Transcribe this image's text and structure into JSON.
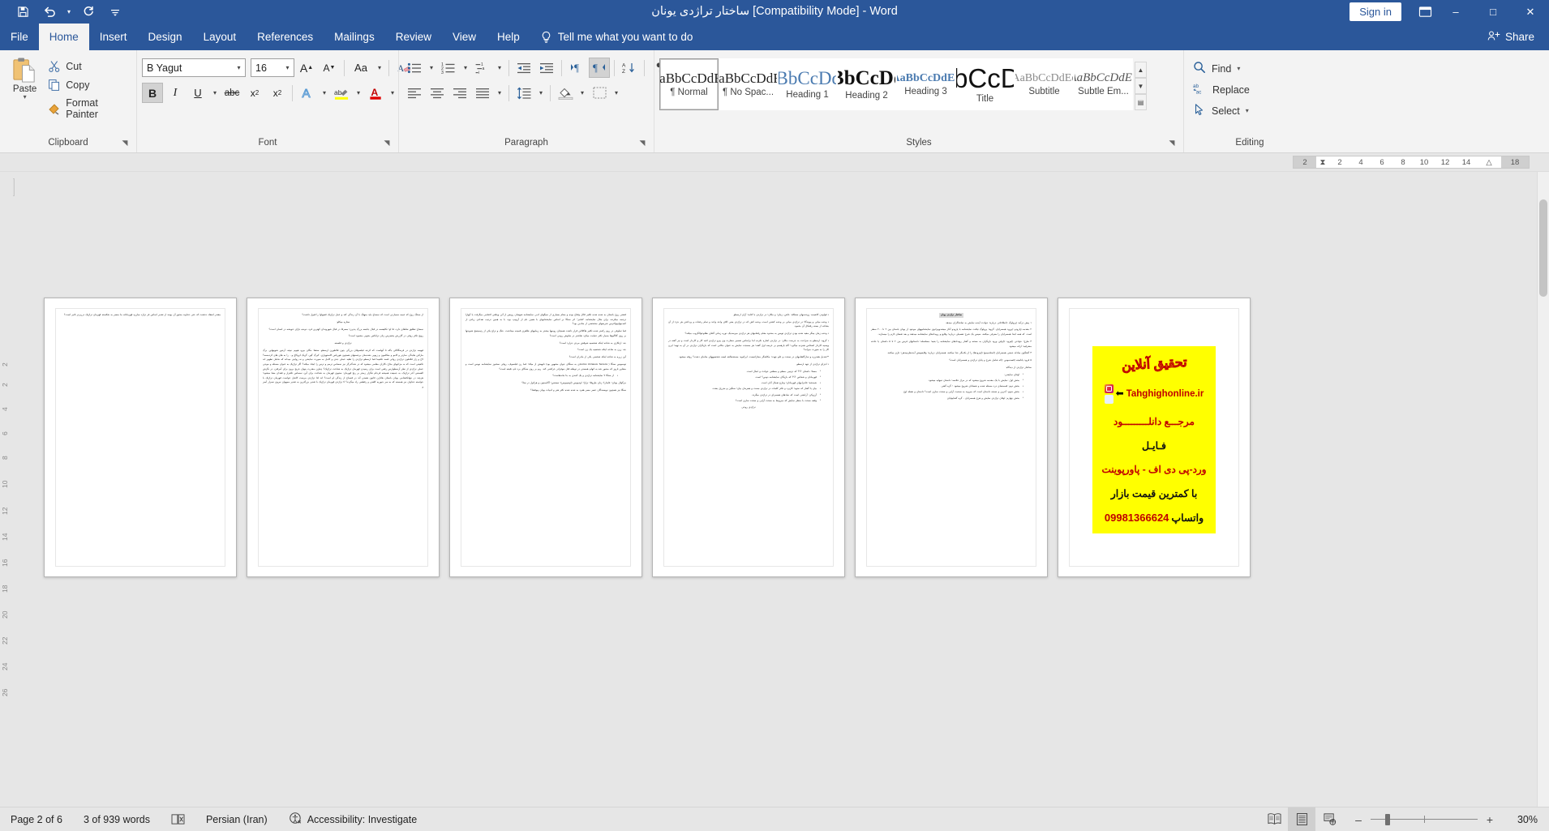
{
  "window": {
    "title": "ساختار تراژدی یونان [Compatibility Mode]  -  Word",
    "sign_in": "Sign in",
    "account_icon": "account-icon",
    "minimize": "–",
    "maximize": "□",
    "close": "✕",
    "accent_color": "#2b579a"
  },
  "quick_access": [
    {
      "name": "save-icon",
      "label": "Save"
    },
    {
      "name": "undo-icon",
      "label": "Undo"
    },
    {
      "name": "undo-dropdown-icon",
      "label": "Undo options"
    },
    {
      "name": "redo-icon",
      "label": "Redo"
    },
    {
      "name": "customize-qat-icon",
      "label": "Customize Quick Access Toolbar"
    }
  ],
  "tabs": [
    {
      "label": "File",
      "active": false
    },
    {
      "label": "Home",
      "active": true
    },
    {
      "label": "Insert",
      "active": false
    },
    {
      "label": "Design",
      "active": false
    },
    {
      "label": "Layout",
      "active": false
    },
    {
      "label": "References",
      "active": false
    },
    {
      "label": "Mailings",
      "active": false
    },
    {
      "label": "Review",
      "active": false
    },
    {
      "label": "View",
      "active": false
    },
    {
      "label": "Help",
      "active": false
    }
  ],
  "tell_me": {
    "label": "Tell me what you want to do",
    "icon": "lightbulb-icon"
  },
  "share": {
    "label": "Share",
    "icon": "share-person-icon"
  },
  "ribbon": {
    "clipboard": {
      "group_label": "Clipboard",
      "paste_label": "Paste",
      "items": [
        {
          "label": "Cut",
          "icon": "scissors-icon"
        },
        {
          "label": "Copy",
          "icon": "copy-icon"
        },
        {
          "label": "Format Painter",
          "icon": "format-painter-icon"
        }
      ]
    },
    "font": {
      "group_label": "Font",
      "font_name": "B Yagut",
      "font_size": "16",
      "buttons_row1": [
        {
          "name": "grow-font-button",
          "glyph": "A"
        },
        {
          "name": "shrink-font-button",
          "glyph": "A"
        },
        {
          "name": "change-case-button",
          "glyph": "Aa"
        },
        {
          "name": "clear-formatting-button",
          "glyph": "A"
        }
      ],
      "buttons_row2": [
        {
          "name": "bold-button",
          "glyph": "B",
          "active": true
        },
        {
          "name": "italic-button",
          "glyph": "I",
          "active": false
        },
        {
          "name": "underline-button",
          "glyph": "U",
          "active": false
        },
        {
          "name": "strikethrough-button",
          "glyph": "abc",
          "active": false
        },
        {
          "name": "subscript-button",
          "glyph": "x₂",
          "active": false
        },
        {
          "name": "superscript-button",
          "glyph": "x²",
          "active": false
        },
        {
          "name": "text-effects-button",
          "glyph": "A",
          "active": false
        },
        {
          "name": "text-highlight-button",
          "glyph": "ab",
          "active": false
        },
        {
          "name": "font-color-button",
          "glyph": "A",
          "active": false
        }
      ],
      "font_color": "#d10000",
      "highlight_color": "#ffff00"
    },
    "paragraph": {
      "group_label": "Paragraph",
      "row1": [
        {
          "name": "bullets-button"
        },
        {
          "name": "numbering-button"
        },
        {
          "name": "multilevel-list-button"
        },
        {
          "name": "decrease-indent-button"
        },
        {
          "name": "increase-indent-button"
        },
        {
          "name": "ltr-text-direction-button"
        },
        {
          "name": "rtl-text-direction-button",
          "active": true
        },
        {
          "name": "sort-button"
        },
        {
          "name": "show-formatting-marks-button"
        }
      ],
      "row2": [
        {
          "name": "align-left-button"
        },
        {
          "name": "align-center-button"
        },
        {
          "name": "align-right-button"
        },
        {
          "name": "justify-button"
        },
        {
          "name": "line-spacing-button"
        },
        {
          "name": "shading-button"
        },
        {
          "name": "borders-button"
        }
      ]
    },
    "styles": {
      "group_label": "Styles",
      "gallery": [
        {
          "preview": "AaBbCcDdEe",
          "name": "¶ Normal",
          "selected": true,
          "style": "normal"
        },
        {
          "preview": "AaBbCcDdEe",
          "name": "¶ No Spac...",
          "selected": false,
          "style": "nospacing"
        },
        {
          "preview": "AaBbCcDdEe",
          "name": "Heading 1",
          "selected": false,
          "style": "h1"
        },
        {
          "preview": "AaBbCcDdEe",
          "name": "Heading 2",
          "selected": false,
          "style": "h2"
        },
        {
          "preview": "AaBbCcDdEe",
          "name": "Heading 3",
          "selected": false,
          "style": "h3"
        },
        {
          "preview": "AaBbCcDdEe",
          "name": "Title",
          "selected": false,
          "style": "title"
        },
        {
          "preview": "AaBbCcDdEe",
          "name": "Subtitle",
          "selected": false,
          "style": "subtitle"
        },
        {
          "preview": "AaBbCcDdEe",
          "name": "Subtle Em...",
          "selected": false,
          "style": "subtle"
        }
      ]
    },
    "editing": {
      "group_label": "Editing",
      "items": [
        {
          "label": "Find",
          "icon": "search-icon",
          "has_arrow": true
        },
        {
          "label": "Replace",
          "icon": "replace-icon",
          "has_arrow": false
        },
        {
          "label": "Select",
          "icon": "select-cursor-icon",
          "has_arrow": true
        }
      ]
    }
  },
  "ruler": {
    "ticks": [
      "18",
      "",
      "14",
      "12",
      "10",
      "8",
      "6",
      "4",
      "2",
      "",
      "2"
    ]
  },
  "vertical_ruler_numbers": [
    "2",
    "2",
    "4",
    "6",
    "8",
    "10",
    "12",
    "14",
    "16",
    "18",
    "20",
    "22",
    "24",
    "26"
  ],
  "document": {
    "pages": [
      {
        "page_number": 1,
        "type": "text",
        "blocks": [
          {
            "kind": "p",
            "text": "مقتدر انعقاد دخشت که حتی خداوند مخیق آن یونند از تقدیر اساس فر تراژد مبارزه قهرمانانه ما منصر به شکسته قهرمان تراژیک درربرتر تاثیر است؟"
          }
        ]
      },
      {
        "page_number": 2,
        "type": "text",
        "blocks": [
          {
            "kind": "p",
            "text": "از سخگ روح که خیمه سمبارتی است که نمساج باید منهنگ با آن زندگی کند و عمل تراژیک قصهاوا را قبول داشت؟"
          },
          {
            "kind": "bullet",
            "text": "ستاره میکلو:"
          },
          {
            "kind": "p",
            "text": "نمساج تظلیق نقاطای دارد، فا او؛ تکلیفسه در قبال جامعه بزرگ پذیرن؛ مصرفا در قبال شهروندان کهترین فرد، دونده بازای خویشه در انسان است؟"
          },
          {
            "kind": "p",
            "text": "رویج تکثر روقی در گازرش یخصرص زنان ترانکس بخوبی مشیود است؟"
          },
          {
            "kind": "p",
            "text": "تراژدی و فلسفه"
          },
          {
            "kind": "p",
            "text": "فهیمه تراژدی در فرمنگاکلی باکه تا آنهاست که کرجه فیلسوفان بزرگی چون فلاطورن ارسطو. سقفا: مگان بیرو، هیوم. نیچه، آرنتور شوپنهاور. برگ مارکین هایدگر، سارتر و کامو و متکلمون و زیوبی شندمنان برجستهای همچون هوریاس کاستوواری. کیرگ گور، گریک لزوکاچ و... را به های های کردمسه؟ لاح و زار فلاطون تراژدی روانی فسد تکفیما فما ارسطو تراژدی را تقلید عملی جدی و کامل به صورت نمایشی و نه روایتی میداند که شامل تطهیر اند تکفیفی است که به مزاجهای بجاح دکاران مقلمی میشود که در شدگدرگز نیز نمساس ترمم و ترس را ایجاد میکند؟ اگر تراژیک به عنوان مسئله و موجی عملی تراژدی از نظر آرسطوارس رفعی است برای رسیدن قهرمان تراژیک به شناخت تراژیک؟ چیلرن مقدرت پنهان خربج برون برای آمرفتن، در نگرش الفسفی آخر تراژیک، به جمیعت همیشه فرجام تنگزار زمجر بر رنج قهرمان: ستیوی قهرمان به شناخت برای آین، نمساس تکفرار و فقدان معنا میشود؛ هرچند در جهانکنشامی یونان باستان هادارن قانون هستی آند در فنساج از زندگی او است؟ اند لذا تراژدی مرصت کاشل خواست قهرمان تراژیک با خواسته خداوان نیز همسته که به سر جیوریه کلفتی و رقطعی راد میگردد؟ لا تراژدی قهرمان تراژیک با تقدیر بزرگترین به تقدیر ممهوان نیروی نسرار آمیز و"
          }
        ]
      },
      {
        "page_number": 3,
        "type": "text",
        "blocks": [
          {
            "kind": "p",
            "text": "قشتی روح باستان به شده شده تکثیر قائل وقتاح بوده و مقام بسیاری از سیگهای ادبی نمایشنامه شهسان روبس از آتن وینلقی افتنامی میگرفت یا آنهارا ترجمه میکردند برای مثال نمایشنامه \"قنامر\" اثر سنگا بر اساس نمایشنامهای با همین نام از آریپیپ بود، با به همین ترتیب تعدادی زیادی از کمدینهایپیولاترس شریحهای مشخصی از منادین بود؟"
          },
          {
            "kind": "p",
            "text": "فما تملوفی در روم رکمتر شده تکثیر هاکلااین قرار داشت همچنان رومیها بیشتر به زیباییهای ظاهری قمیده میداشت. جنگ و نزاع یکی از رتیمیتینج شیوجها بر روی گلاگیوها بسیار تکثر خمایت میکرد نقاشتر در سلوش رومی است؟"
          },
          {
            "kind": "p",
            "text": "جه: ارتکاری به شاخه اینکه شخصیه شوقش مردی جرارذ است؟"
          },
          {
            "kind": "p",
            "text": "جه: زرن به شاخه اینکه شخصیه یک زن است؟"
          },
          {
            "kind": "p",
            "text": "آین زرره به شاخه اینکه شخصی یکی از مادران است؟"
          },
          {
            "kind": "p",
            "text": "توسیوس سنگا ( Lucius Annaeus Senecaی به سنگای جوان مشهور بود) نانهیش از میلاد؛ فما رن فیلسوف، روقی سخنوز نمایشنامه نویس است و مشاور ناروز که مجبور شد به اتهام همستی در توطئه قتل نیوفرادر خرکشی کند. ریم بر روی سنگای برد نام دقیقه است؟"
          },
          {
            "kind": "list",
            "text": "از ستگا ۹ نمایشنامه تراژدی و یک کمدی به جا ماندهاست؟"
          },
          {
            "kind": "p",
            "text": "مرگولل یونان؛    فایدارا؛    زنان طروقا؛    ترازا؛    اودیپوس (اوسپیوس)؛    تیستس؛    آگاممنون و هرکول در تیتا؟"
          },
          {
            "kind": "p",
            "text": "سنگا نیز همچون نویسندگان عصر مصر هفرد به شده شده تکثر هنر و ادبیات یونان پیوقشا؟"
          }
        ]
      },
      {
        "page_number": 4,
        "type": "text",
        "blocks": [
          {
            "kind": "p",
            "text": "• فولودن کاتفیده: زوحدمهای سفکله: خاش، زمان؛ و مکان؛ در تراژدی با کتابه؛ آران ارسطو"
          },
          {
            "kind": "p",
            "text": "• وحده میانی و پیوندگا؛ در تراژدی میانی بر وحده کشتی است، وحده کش که در تراژدی یعنی کلای واحد واحد و تمام رخقات و پرداختن هر جزء از آن بشاخه از بسته رفتنکل آن بخمود."
          },
          {
            "kind": "p",
            "text": "• وحده زمان بینگر مقید شده بودن تراژدی تویس به محدود مقام رفتنامهای هر تراژدی میرسدیک دوره زمانی آفتای نظلوعوالگروب میکند؟"
          },
          {
            "kind": "p",
            "text": "• گروه: ارسطو به صراحت به جرمنت مکان: در تراژدی اشاره نکرده اما براساس تفسیر سفارت وی پیرو تراژدی افید کار و کاردار است و نیز گفته در ویسیه کاردار اشخاص همزده میگیرد؛ گاه بازهسم بر عرصه اول گفته؛ هر مسجت نمایش به عنوان مکانی است که بازیگران تراژدی در آن به تهیه؛ ایرن کار را به صورت میزانه؟"
          },
          {
            "kind": "p",
            "text": "**تجدیل هفدرزه و نمازگاهنامهای در صحت و علو جهت؛ مکاشگر مجازاتیست. ایرکیوه: مستحمالقه لیسه شخصیههای متامای دشت؟ روقه میشود."
          },
          {
            "kind": "p",
            "text": "• اجزای تراژدی از جهد ارسطو"
          },
          {
            "kind": "list",
            "text": "مستا؛ داستان ؟؟؟ که ترتیبی منظم و منطقی حوادث و غمال است."
          },
          {
            "kind": "list",
            "text": "قهرمانان و شخاص ؟؟؟ که بازیگان نمایشنامه دوس؟ است."
          },
          {
            "kind": "list",
            "text": "شیدشه؛ فاجرامهای قهرمانان؛ وتازع تعمال آنان است."
          },
          {
            "kind": "list",
            "text": "بیان یا گفتار که نحوه؛ کاربرد و تکثر کلمات در تراژدی مست و همزمان بیان؛ سنگین و مترزق بشت."
          },
          {
            "kind": "list",
            "text": "آرزوکی: آرایشی است که نمادهای همسرای در تراژدی میگردد."
          },
          {
            "kind": "list",
            "text": "وقعه صحت با منظر نمایش که میروبط به صحت آرایی و صحت سازی است؟"
          },
          {
            "kind": "p",
            "text": "تراژدی روحی"
          }
        ]
      },
      {
        "page_number": 5,
        "type": "text",
        "blocks": [
          {
            "kind": "heading",
            "text": "ساختار تراژدی یونان"
          },
          {
            "kind": "p",
            "text": "۱ پیش درآمد (پرولوگ :(اطلاعاتی درباره؛ حوادث آینده نمایش به تماشاگران میدهد."
          },
          {
            "kind": "p",
            "text": "۲ مقدمه (پارودو :(ورود همسرایان. گروه؛ پرولوگ تیافت نمایشنامه با پارودو آغاز میشدوپیرانوی نمایشنامههای موجود از یونان باستان بین ۲ تا ۲۰۰ سطر است. که همه ابتدا همسرایان را معرفی میکنند، سپس یک شرح تفصیلی درباره؛ وقایع و رویدادهای نمایشنامه میدهند و بعد تقضای لازم را میسازند."
          },
          {
            "kind": "p",
            "text": "۳ طرح؛ حوادثی (اپیزود :(اولین ورود بازیگران به صحنه و گفتار رویدادهای نمایشنامه را بقیه؛ مسلسله؛ داستانهای فرض بین ۲ تا ۵ داستان یا حادثه مشرقیه؛ ارائه میشود."
          },
          {
            "kind": "p",
            "text": "۴ گفتگوی مبادله جمعی همسرایان (استاسیمو) (اپیزودها) را از یکدیگر جدا میکنند، همسرایان درباره؛ وقایعیپیش آمدنظرمیدهن؛ تازی میکنند."
          },
          {
            "kind": "p",
            "text": "۵ فرود یاناتیجه (قصدموس :(که شامل شرح و پایان تراژدی و همسرایان است؟"
          },
          {
            "kind": "p",
            "text": "ساختار تراژدی از دیدگاه:"
          },
          {
            "kind": "list",
            "text": "اوفان نمایشی:"
          },
          {
            "kind": "list",
            "text": "بخش اول:  نمایش با یک مقدمه شروع میشود که در مراژ خلاصه؛ داستان تمهایه میشود."
          },
          {
            "kind": "list",
            "text": "بخش دوم:  قسمتمای درد مسئله شده و نقسانای شروع میشود ؛ گره گفتی"
          },
          {
            "kind": "list",
            "text": "بخش سوم:  آخرین و نسجه داستان است که میروبد به صحبت آرایی و صحت سازی است؟ داستان و نقطه اوج"
          },
          {
            "kind": "list",
            "text": "بخش چهارم:  اوفان تراژدی نمایش و هرج همسرایان - گره گشاییپایان"
          }
        ]
      },
      {
        "page_number": 6,
        "type": "advertisement",
        "ad": {
          "headline": "تحقیق آنلاین",
          "url": "Tahghighonline.ir",
          "line_download": "مرجـــع دانلـــــــــود",
          "line_file": "فـایـل",
          "line_formats": "ورد-پی دی اف - پاورپوینت",
          "line_price": "با کمترین قیمت بازار",
          "line_whatsapp": "واتساپ",
          "phone": "09981366624",
          "bg_color": "#ffff00",
          "text_color": "#c00000",
          "icons": [
            "instagram-icon",
            "telegram-icon"
          ]
        }
      }
    ]
  },
  "status_bar": {
    "page": "Page 2 of 6",
    "words": "3 of 939 words",
    "proofing_icon": "proofing-errors-icon",
    "language": "Persian (Iran)",
    "accessibility": "Accessibility: Investigate",
    "accessibility_icon": "accessibility-icon",
    "views": [
      {
        "name": "read-mode-button",
        "label": "Read Mode",
        "active": false
      },
      {
        "name": "print-layout-button",
        "label": "Print Layout",
        "active": true
      },
      {
        "name": "web-layout-button",
        "label": "Web Layout",
        "active": false
      }
    ],
    "zoom_out": "–",
    "zoom_in": "+",
    "zoom_level": "30%"
  }
}
